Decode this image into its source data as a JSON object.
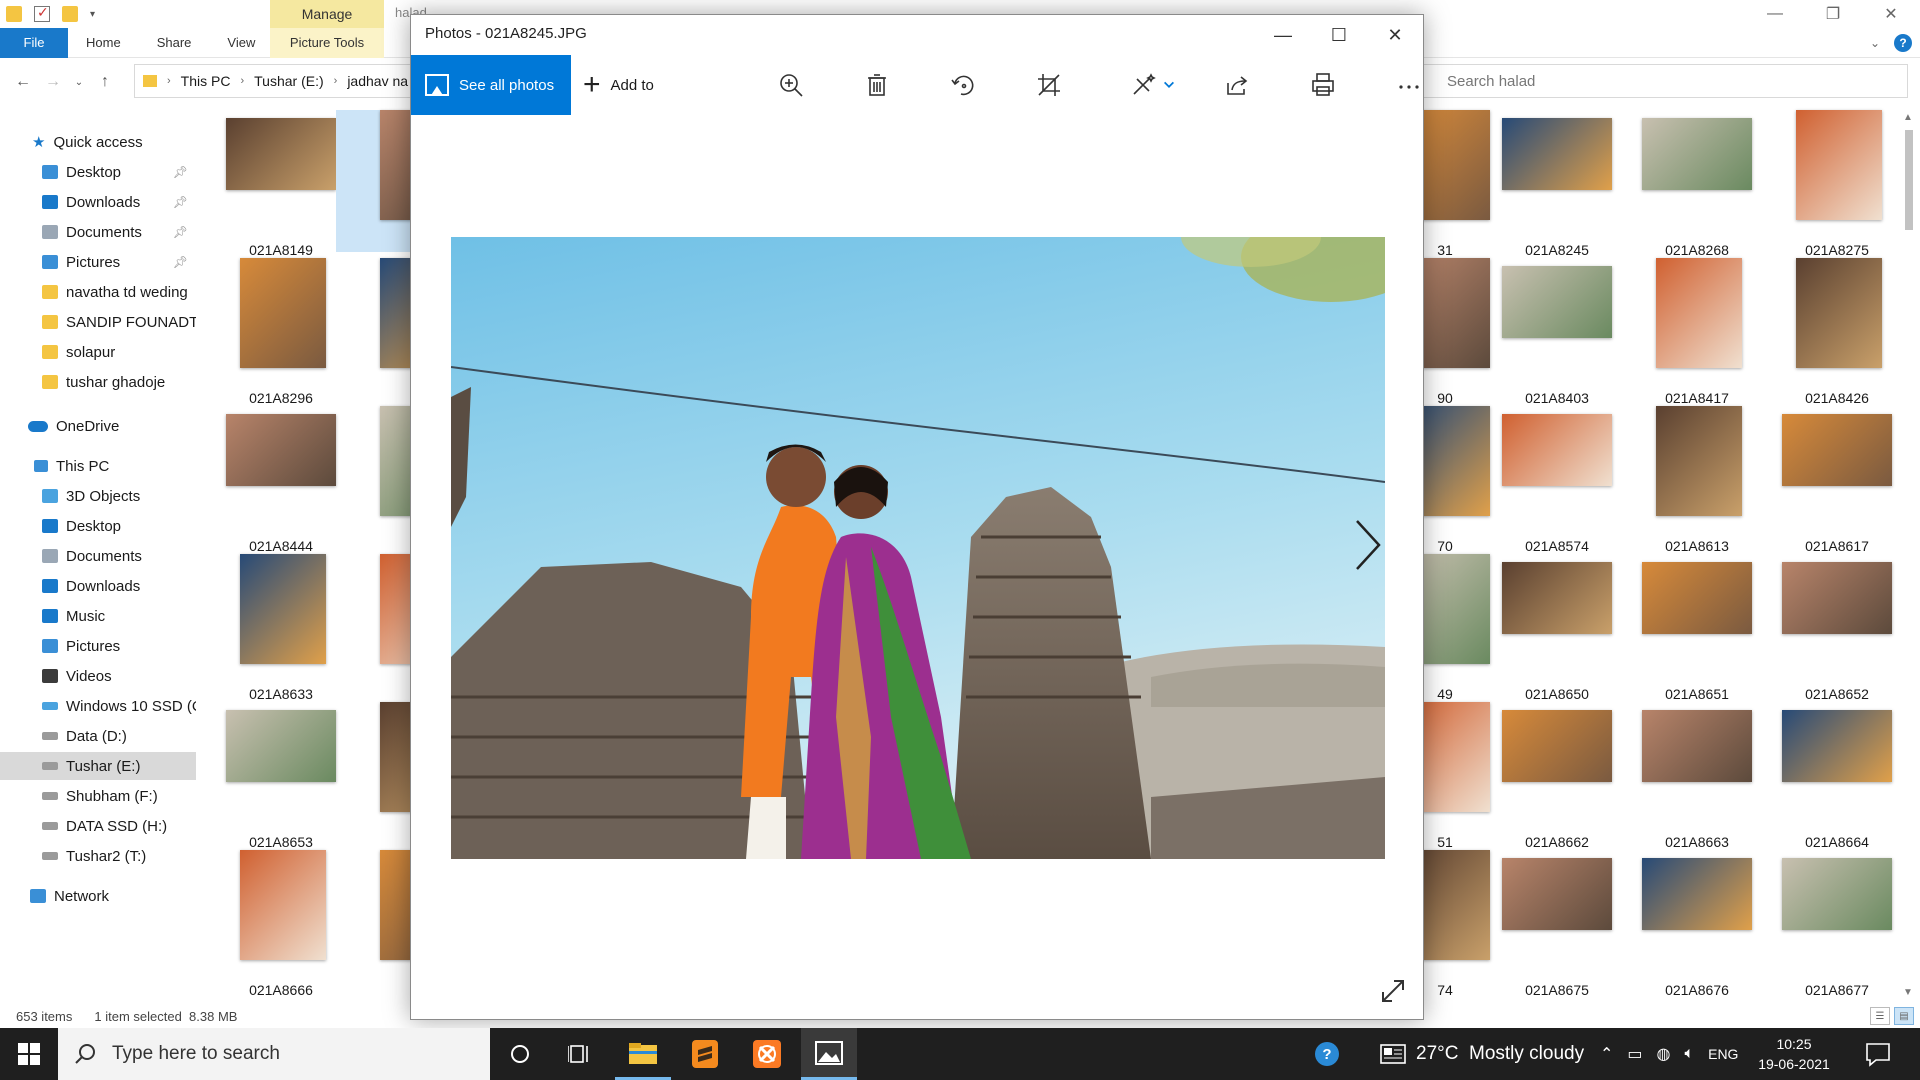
{
  "explorer": {
    "ribbon": {
      "manage": "Manage",
      "title_fragment": "halad",
      "tabs": [
        "File",
        "Home",
        "Share",
        "View"
      ],
      "picture_tools": "Picture Tools"
    },
    "address": {
      "segments": [
        "This PC",
        "Tushar (E:)",
        "jadhav na"
      ]
    },
    "search": {
      "placeholder": "Search halad"
    },
    "nav": {
      "quick_access": "Quick access",
      "quick_items": [
        {
          "label": "Desktop",
          "pinned": true
        },
        {
          "label": "Downloads",
          "pinned": true
        },
        {
          "label": "Documents",
          "pinned": true
        },
        {
          "label": "Pictures",
          "pinned": true
        },
        {
          "label": "navatha td weding",
          "pinned": false
        },
        {
          "label": "SANDIP FOUNADTI(",
          "pinned": false
        },
        {
          "label": "solapur",
          "pinned": false
        },
        {
          "label": "tushar ghadoje",
          "pinned": false
        }
      ],
      "onedrive": "OneDrive",
      "this_pc": "This PC",
      "pc_items": [
        "3D Objects",
        "Desktop",
        "Documents",
        "Downloads",
        "Music",
        "Pictures",
        "Videos",
        "Windows 10 SSD (C",
        "Data (D:)",
        "Tushar (E:)",
        "Shubham (F:)",
        "DATA SSD (H:)",
        "Tushar2 (T:)"
      ],
      "network": "Network"
    },
    "left_files": {
      "col1": [
        "021A8149",
        "021A8296",
        "021A8444",
        "021A8633",
        "021A8653",
        "021A8666"
      ],
      "col2": [
        "02",
        "02",
        "02",
        "02",
        "02",
        "02"
      ]
    },
    "right_files": {
      "partial": [
        "31",
        "90",
        "70",
        "49",
        "51",
        "74"
      ],
      "col_a": [
        "021A8245",
        "021A8403",
        "021A8574",
        "021A8650",
        "021A8662",
        "021A8675"
      ],
      "col_b": [
        "021A8268",
        "021A8417",
        "021A8613",
        "021A8651",
        "021A8663",
        "021A8676"
      ],
      "col_c": [
        "021A8275",
        "021A8426",
        "021A8617",
        "021A8652",
        "021A8664",
        "021A8677"
      ]
    },
    "status": {
      "count": "653 items",
      "selected": "1 item selected",
      "size": "8.38 MB"
    }
  },
  "photos": {
    "title": "Photos - 021A8245.JPG",
    "see_all": "See all photos",
    "add_to": "Add to"
  },
  "taskbar": {
    "search_placeholder": "Type here to search",
    "weather": "27°C  Mostly cloudy",
    "lang": "ENG",
    "time": "10:25",
    "date": "19-06-2021"
  },
  "colors": {
    "accent": "#0078d7",
    "file_tab": "#1979ca",
    "manage_tab": "#f5e8a0",
    "taskbar": "#1f1f1f",
    "selection": "#cce4f7"
  }
}
